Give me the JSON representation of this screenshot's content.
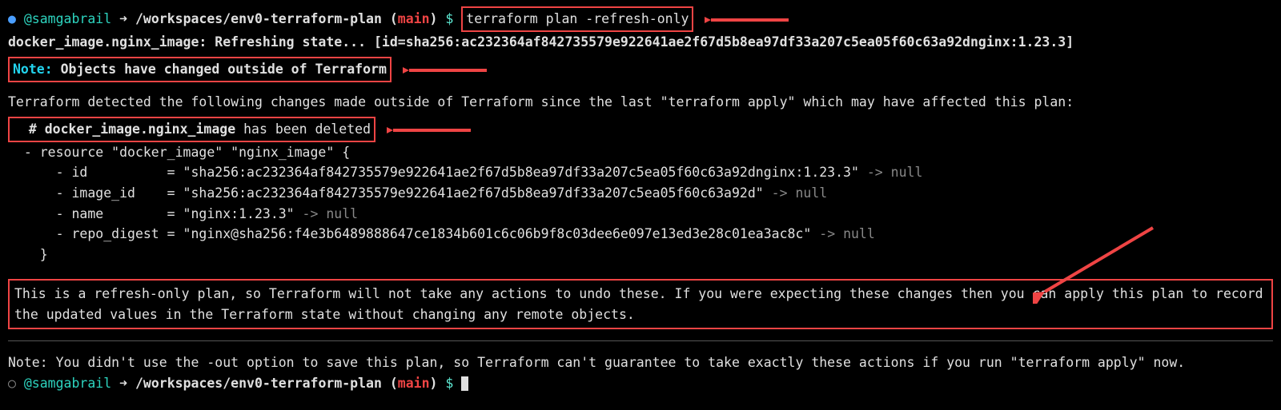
{
  "prompt1": {
    "bullet": "●",
    "user": "@samgabrail",
    "arrow": "➜",
    "path": "/workspaces/env0-terraform-plan",
    "branch_open": "(",
    "branch": "main",
    "branch_close": ")",
    "dollar": "$",
    "command": "terraform plan -refresh-only"
  },
  "refresh_line": "docker_image.nginx_image: Refreshing state... [id=sha256:ac232364af842735579e922641ae2f67d5b8ea97df33a207c5ea05f60c63a92dnginx:1.23.3]",
  "note_prefix": "Note:",
  "note_text": " Objects have changed outside of Terraform",
  "detected_line": "Terraform detected the following changes made outside of Terraform since the last \"terraform apply\" which may have affected this plan:",
  "deleted_comment": "  # docker_image.nginx_image",
  "deleted_suffix": " has been deleted",
  "resource_line": "  - resource \"docker_image\" \"nginx_image\" {",
  "attrs": {
    "id": "      - id          = \"sha256:ac232364af842735579e922641ae2f67d5b8ea97df33a207c5ea05f60c63a92dnginx:1.23.3\"",
    "image_id": "      - image_id    = \"sha256:ac232364af842735579e922641ae2f67d5b8ea97df33a207c5ea05f60c63a92d\"",
    "name": "      - name        = \"nginx:1.23.3\"",
    "repo_digest": "      - repo_digest = \"nginx@sha256:f4e3b6489888647ce1834b601c6c06b9f8c03dee6e097e13ed3e28c01ea3ac8c\""
  },
  "to_null": " -> null",
  "close_brace": "    }",
  "refresh_explain": "This is a refresh-only plan, so Terraform will not take any actions to undo these. If you were expecting these changes then you can apply this plan to record the updated values in the Terraform state without changing any remote objects.",
  "note2": "Note: You didn't use the -out option to save this plan, so Terraform can't guarantee to take exactly these actions if you run \"terraform apply\" now.",
  "prompt2": {
    "bullet": "○",
    "user": "@samgabrail",
    "arrow": "➜",
    "path": "/workspaces/env0-terraform-plan",
    "branch_open": "(",
    "branch": "main",
    "branch_close": ")",
    "dollar": "$"
  }
}
